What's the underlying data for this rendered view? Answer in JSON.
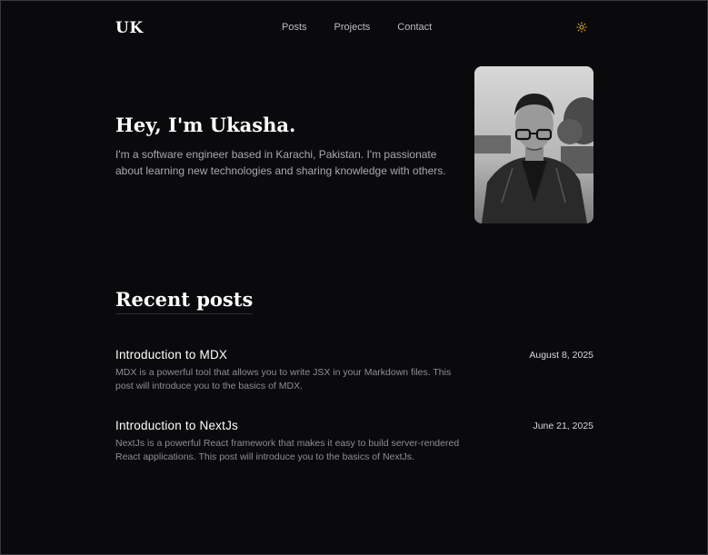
{
  "header": {
    "logo": "UK",
    "nav": [
      {
        "label": "Posts"
      },
      {
        "label": "Projects"
      },
      {
        "label": "Contact"
      }
    ],
    "theme_toggle_icon": "sun-icon",
    "accent_color": "#e0a93a"
  },
  "hero": {
    "title": "Hey, I'm Ukasha.",
    "description": "I'm a software engineer based in Karachi, Pakistan. I'm passionate about learning new technologies and sharing knowledge with others."
  },
  "recent_posts": {
    "heading": "Recent posts",
    "items": [
      {
        "title": "Introduction to MDX",
        "date": "August 8, 2025",
        "summary": "MDX is a powerful tool that allows you to write JSX in your Markdown files. This post will introduce you to the basics of MDX."
      },
      {
        "title": "Introduction to NextJs",
        "date": "June 21, 2025",
        "summary": "NextJs is a powerful React framework that makes it easy to build server-rendered React applications. This post will introduce you to the basics of NextJs."
      }
    ]
  }
}
